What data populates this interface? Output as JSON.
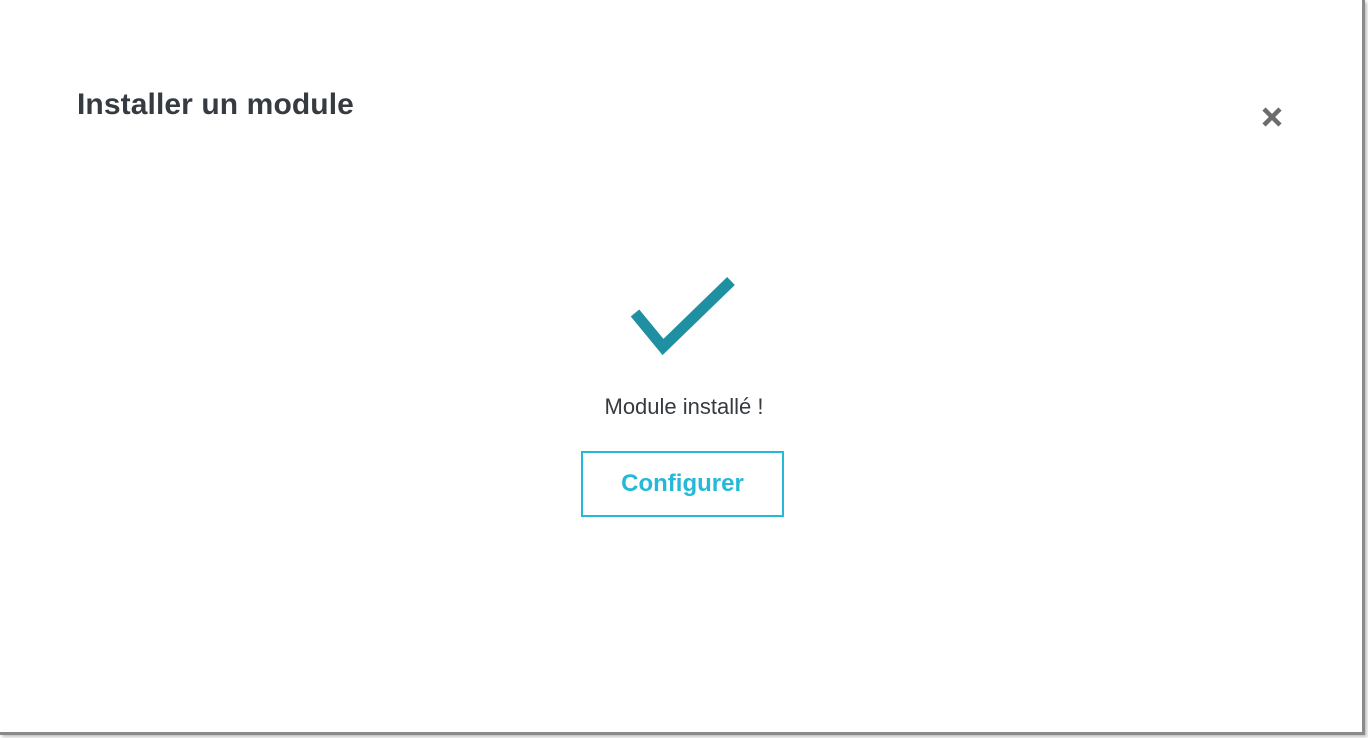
{
  "modal": {
    "title": "Installer un module",
    "close_icon": "close-icon"
  },
  "result": {
    "icon": "checkmark-icon",
    "message": "Module installé !",
    "configure_label": "Configurer"
  },
  "colors": {
    "accent": "#25b9d7",
    "checkmark": "#1f8fa2",
    "title_text": "#363a41",
    "close_icon": "#6c6c6c"
  }
}
